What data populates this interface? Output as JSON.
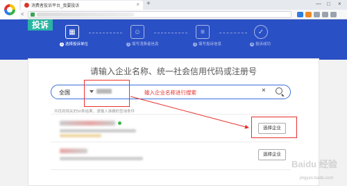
{
  "browser": {
    "tab_title": "消费者投诉平台_我要投诉",
    "tab_close": "×",
    "new_tab": "+",
    "nav": {
      "back": "<",
      "forward": ">",
      "refresh": "C",
      "home": "⌂"
    },
    "window_controls": [
      "—",
      "□",
      "×"
    ]
  },
  "hero": {
    "badge": "投诉",
    "steps": [
      {
        "number": "1",
        "label": "选择投诉单位",
        "active": true
      },
      {
        "number": "2",
        "label": "填写消费者信息",
        "active": false
      },
      {
        "number": "3",
        "label": "填写投诉信息",
        "active": false
      },
      {
        "number": "4",
        "label": "投诉成功",
        "active": false
      }
    ]
  },
  "search": {
    "heading": "请输入企业名称、统一社会信用代码或注册号",
    "region": "全国",
    "clear": "×",
    "hint": "共找到相关的50条结果，请输入准确的查询条件"
  },
  "results": [
    {
      "button": "选择企业"
    },
    {
      "button": "选择企业"
    }
  ],
  "annotation": {
    "text": "输入企业名称进行搜索",
    "color": "#e8302c"
  },
  "watermark": {
    "text": "Baidu 经验",
    "sub": "jingyan.baidu.com"
  }
}
